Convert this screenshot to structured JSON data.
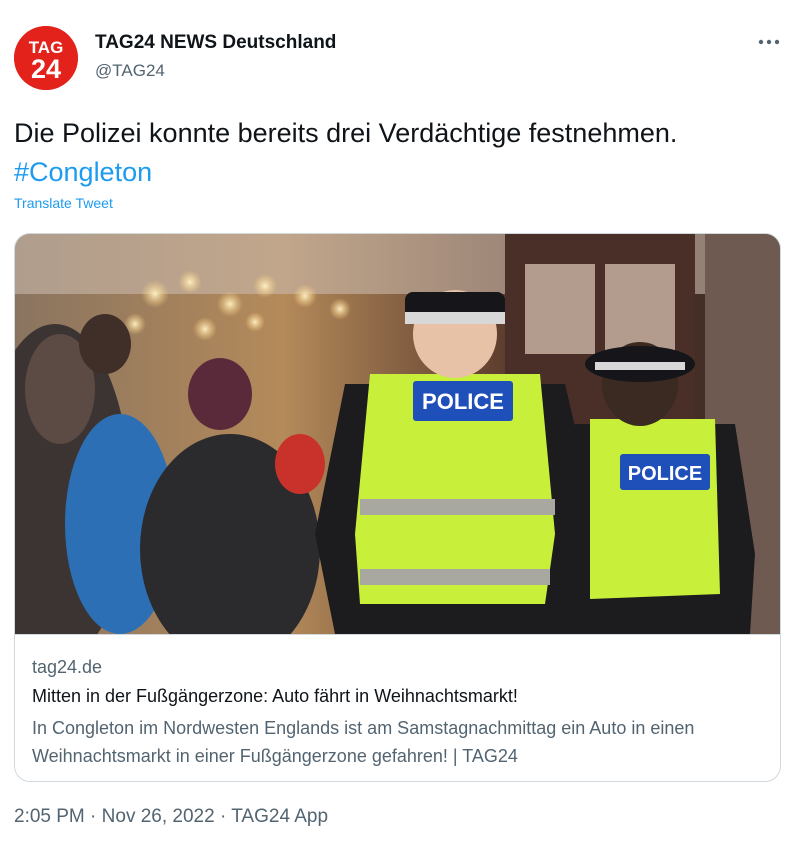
{
  "author": {
    "name": "TAG24 NEWS Deutschland",
    "handle": "@TAG24",
    "avatar_text_top": "TAG",
    "avatar_text_bottom": "24"
  },
  "more_icon": "more-horizontal-icon",
  "tweet": {
    "text": "Die Polizei konnte bereits drei Verdächtige festnehmen.",
    "hashtag": "#Congleton",
    "translate_label": "Translate Tweet"
  },
  "card": {
    "image": {
      "vest_label_1": "POLICE",
      "vest_label_2": "POLICE"
    },
    "domain": "tag24.de",
    "title": "Mitten in der Fußgängerzone: Auto fährt in Weihnachtsmarkt!",
    "description": "In Congleton im Nordwesten Englands ist am Samstagnachmittag ein Auto in einen Weihnachtsmarkt in einer Fußgängerzone gefahren! | TAG24"
  },
  "meta": {
    "time": "2:05 PM",
    "separator": "·",
    "date": "Nov 26, 2022",
    "source": "TAG24 App"
  },
  "colors": {
    "brand_red": "#e3231b",
    "link_blue": "#1d9bf0",
    "muted": "#536471",
    "vest_yellow": "#c8f03a"
  }
}
